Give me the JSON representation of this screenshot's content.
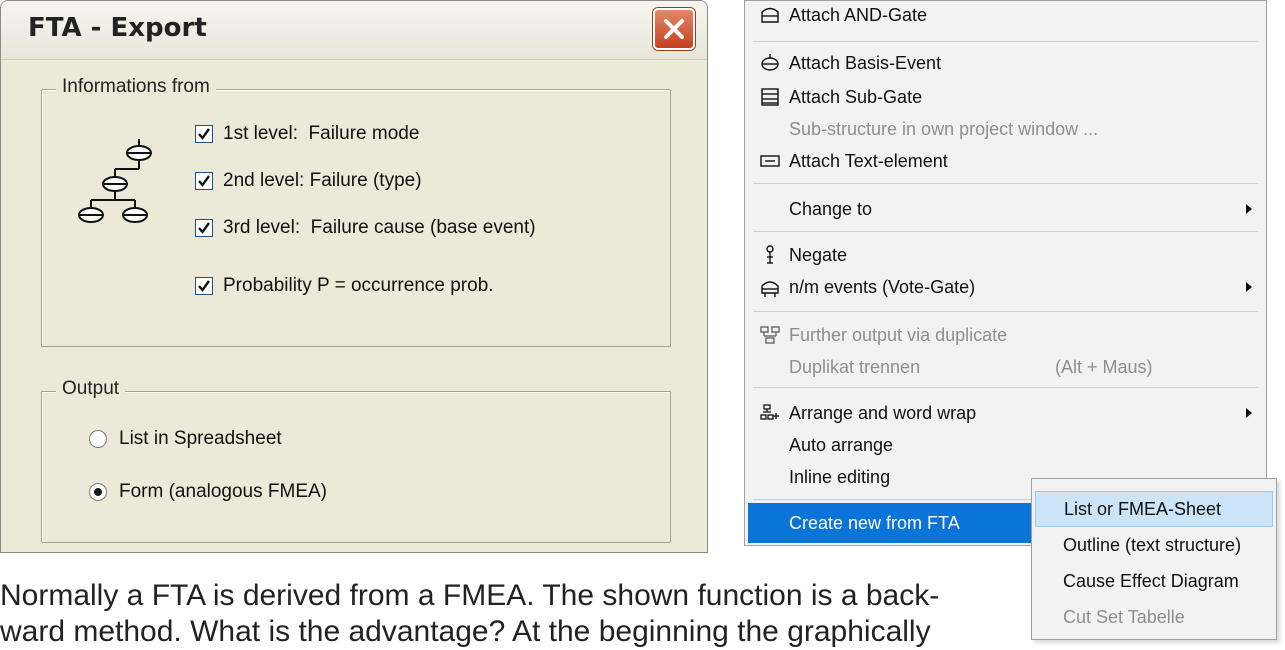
{
  "dialog": {
    "title": "FTA - Export",
    "info_group": {
      "legend": "Informations from",
      "checkboxes": [
        {
          "label": "1st level:  Failure mode",
          "checked": true
        },
        {
          "label": "2nd level: Failure (type)",
          "checked": true
        },
        {
          "label": "3rd level:  Failure cause (base event)",
          "checked": true
        },
        {
          "label": "Probability P = occurrence prob.",
          "checked": true
        }
      ]
    },
    "output_group": {
      "legend": "Output",
      "radios": [
        {
          "label": "List in Spreadsheet",
          "selected": false
        },
        {
          "label": "Form (analogous FMEA)",
          "selected": true
        }
      ]
    }
  },
  "menu": {
    "items": [
      {
        "label": "Attach AND-Gate",
        "icon": "and-gate-icon",
        "enabled": true
      },
      {
        "label": "Attach Basis-Event",
        "icon": "basis-event-icon",
        "enabled": true
      },
      {
        "label": "Attach Sub-Gate",
        "icon": "sub-gate-icon",
        "enabled": true
      },
      {
        "label": "Sub-structure in own project window ...",
        "enabled": false
      },
      {
        "label": "Attach Text-element",
        "icon": "text-element-icon",
        "enabled": true
      },
      {
        "label": "Change to",
        "submenu": true,
        "enabled": true
      },
      {
        "label": "Negate",
        "icon": "negate-icon",
        "enabled": true
      },
      {
        "label": "n/m events (Vote-Gate)",
        "icon": "vote-gate-icon",
        "submenu": true,
        "enabled": true
      },
      {
        "label": "Further output via duplicate",
        "icon": "duplicate-icon",
        "enabled": false
      },
      {
        "label": "Duplikat trennen",
        "shortcut": "(Alt + Maus)",
        "enabled": false
      },
      {
        "label": "Arrange and word wrap",
        "icon": "arrange-icon",
        "submenu": true,
        "enabled": true
      },
      {
        "label": "Auto arrange",
        "enabled": true
      },
      {
        "label": "Inline editing",
        "enabled": true
      },
      {
        "label": "Create new from FTA",
        "submenu": true,
        "highlighted": true,
        "enabled": true
      }
    ]
  },
  "submenu": {
    "items": [
      {
        "label": "List or FMEA-Sheet",
        "hovered": true,
        "enabled": true
      },
      {
        "label": "Outline (text structure)",
        "enabled": true
      },
      {
        "label": "Cause Effect Diagram",
        "enabled": true
      },
      {
        "label": "Cut Set Tabelle",
        "enabled": false
      }
    ]
  },
  "caption": {
    "line1": "Normally a FTA is derived from a FMEA. The shown function is a back-",
    "line2": "ward method. What is the advantage? At the beginning the graphically"
  },
  "colors": {
    "dialog_bg": "#ece9d8",
    "menu_bg": "#f2f2f2",
    "highlight": "#0a74d8",
    "submenu_hover": "#cce4f7",
    "close_button": "#c5401f",
    "disabled_text": "#8e8e8e"
  }
}
